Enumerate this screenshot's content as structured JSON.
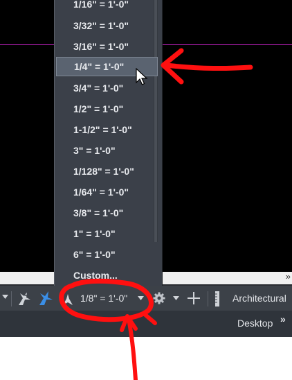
{
  "scale_menu": {
    "items": [
      {
        "label": "1/16\" = 1'-0\""
      },
      {
        "label": "3/32\" = 1'-0\""
      },
      {
        "label": "3/16\" = 1'-0\""
      },
      {
        "label": "1/4\" = 1'-0\"",
        "highlighted": true
      },
      {
        "label": "3/4\" = 1'-0\""
      },
      {
        "label": "1/2\" = 1'-0\""
      },
      {
        "label": "1-1/2\" = 1'-0\""
      },
      {
        "label": "3\" = 1'-0\""
      },
      {
        "label": "1/128\" = 1'-0\""
      },
      {
        "label": "1/64\" = 1'-0\""
      },
      {
        "label": "3/8\" = 1'-0\""
      },
      {
        "label": "1\" = 1'-0\""
      },
      {
        "label": "6\" = 1'-0\""
      },
      {
        "label": "Custom..."
      }
    ]
  },
  "statusbar": {
    "annotation_scale": "1/8\" = 1'-0\"",
    "units": "Architectural",
    "icons": [
      "dropdown-arrow",
      "annotation-visibility-icon",
      "auto-scale-icon",
      "annotation-scale-icon",
      "gear-icon",
      "plus-icon",
      "ruler-icon"
    ]
  },
  "tabbar": {
    "label": "Desktop",
    "overflow": "»"
  },
  "overflow_chevron": "»",
  "colors": {
    "canvas": "#000000",
    "crosshair": "#b01fb0",
    "menu_bg": "#3b4049",
    "highlight": "#5a6370",
    "statusbar": "#3c4148",
    "annotation_red": "#ff1010",
    "accent_blue": "#3a8ee6"
  }
}
